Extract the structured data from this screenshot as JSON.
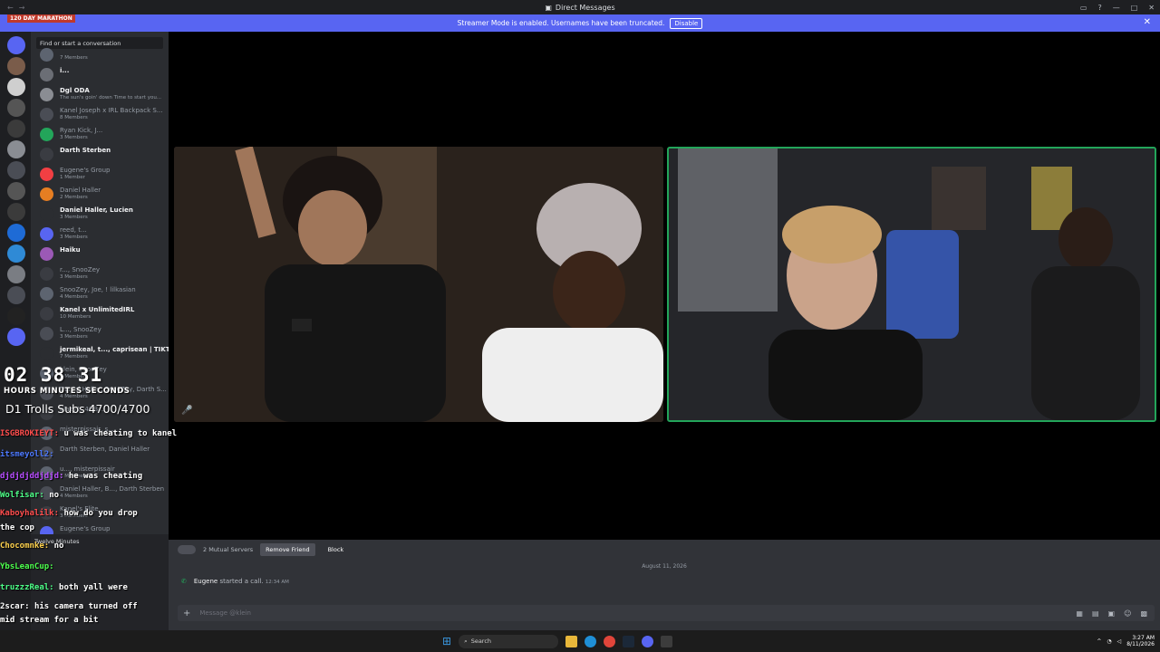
{
  "window": {
    "title": "Direct Messages"
  },
  "banner": {
    "text": "Streamer Mode is enabled. Usernames have been truncated.",
    "button": "Disable"
  },
  "search": {
    "placeholder": "Find or start a conversation"
  },
  "stream_overlay": {
    "marathon": "120 DAY MARATHON",
    "timer": "02 38 31",
    "units": "HOURS  MINUTES  SECONDS",
    "subs": "D1 Trolls Subs 4700/4700"
  },
  "dms": [
    {
      "name": "",
      "sub": "7 Members",
      "bold": false,
      "color": "#5d6470"
    },
    {
      "name": "i...",
      "sub": "",
      "bold": true,
      "color": "#6b6e75"
    },
    {
      "name": "Dgl",
      "tag": "ODA",
      "sub": "The sun's goin' down Time to start you...",
      "bold": true,
      "color": "#8a8d93"
    },
    {
      "name": "Kanel Joseph x IRL Backpack S...",
      "sub": "8 Members",
      "bold": false,
      "color": "#4a4d55"
    },
    {
      "name": "Ryan Kick, J...",
      "sub": "3 Members",
      "bold": false,
      "color": "#23a55a"
    },
    {
      "name": "Darth Sterben",
      "sub": "",
      "bold": true,
      "color": "#3a3c42"
    },
    {
      "name": "Eugene's Group",
      "sub": "1 Member",
      "bold": false,
      "color": "#f23f43"
    },
    {
      "name": "Daniel Haller",
      "sub": "2 Members",
      "bold": false,
      "color": "#e67e22"
    },
    {
      "name": "Daniel Haller, Lucien",
      "sub": "3 Members",
      "bold": true,
      "color": "#2b2d31"
    },
    {
      "name": "reed, t...",
      "sub": "3 Members",
      "bold": false,
      "color": "#5865f2"
    },
    {
      "name": "Haiku",
      "sub": "",
      "bold": true,
      "color": "#9b59b6"
    },
    {
      "name": "r..., SnooZey",
      "sub": "3 Members",
      "bold": false,
      "color": "#3a3c42"
    },
    {
      "name": "SnooZey, Joe, ! lilkasian",
      "sub": "4 Members",
      "bold": false,
      "color": "#5d6470"
    },
    {
      "name": "Kanel x UnlimitedIRL",
      "sub": "10 Members",
      "bold": true,
      "color": "#3a3c42"
    },
    {
      "name": "L..., SnooZey",
      "sub": "3 Members",
      "bold": false,
      "color": "#4a4d55"
    },
    {
      "name": "jermikeal, t..., caprisean | TIKTO...",
      "sub": "7 Members",
      "bold": true,
      "color": "#2b2d31"
    },
    {
      "name": "klein, SnooZey",
      "sub": "3 Members",
      "bold": false,
      "color": "#5d6470"
    },
    {
      "name": "Daniel Haller, SnooZey, Darth S...",
      "sub": "4 Members",
      "bold": false,
      "color": "#4a4d55"
    },
    {
      "name": "blazy1, 4GB...",
      "sub": "",
      "bold": false,
      "color": "#3a3c42"
    },
    {
      "name": "misterpissair, s...",
      "sub": "",
      "bold": false,
      "color": "#5d6470"
    },
    {
      "name": "Darth Sterben, Daniel Haller",
      "sub": "",
      "bold": false,
      "color": "#4a4d55"
    },
    {
      "name": "u..., misterpissair",
      "sub": "3 Members",
      "bold": false,
      "color": "#5d6470"
    },
    {
      "name": "Daniel Haller, B..., Darth Sterben",
      "sub": "4 Members",
      "bold": false,
      "color": "#4a4d55"
    },
    {
      "name": "Kanel's Elite",
      "sub": "3 Members",
      "bold": false,
      "color": "#3a3c42"
    },
    {
      "name": "Eugene's Group",
      "sub": "",
      "bold": false,
      "color": "#5865f2"
    }
  ],
  "chat": [
    {
      "user": "ISGBROKIEYT:",
      "msg": "u was cheating to kanel",
      "ucolor": "#ff4d4d"
    },
    {
      "user": "itsmeyoll2:",
      "msg": "",
      "ucolor": "#4d79ff"
    },
    {
      "user": "djdjdjddjdjd:",
      "msg": "he was cheating",
      "ucolor": "#b84dff"
    },
    {
      "user": "Wolfisar:",
      "msg": "no",
      "ucolor": "#4dff88"
    },
    {
      "user": "Kaboyhalilk:",
      "msg": "how do you drop",
      "ucolor": "#ff4d4d"
    },
    {
      "user": "",
      "msg": "the cop",
      "ucolor": "#ffffff"
    },
    {
      "user": "Chocomnke:",
      "msg": "no",
      "ucolor": "#ffd24d"
    },
    {
      "user": "YbsLeanCup:",
      "msg": "",
      "ucolor": "#4dff4d"
    },
    {
      "user": "truzzzReal:",
      "msg": "both yall were",
      "ucolor": "#4dff88"
    },
    {
      "user": "2scar:",
      "msg": "his camera turned off",
      "ucolor": "#ffffff"
    },
    {
      "user": "",
      "msg": "mid stream for a bit",
      "ucolor": "#ffffff"
    }
  ],
  "user_panel": {
    "status": "Twelve Minutes"
  },
  "profile": {
    "mutual": "2 Mutual Servers",
    "remove": "Remove Friend",
    "block": "Block"
  },
  "conversation": {
    "date": "August 11, 2026",
    "caller": "Eugene",
    "action": "started a call.",
    "time": "12:34 AM"
  },
  "composer": {
    "placeholder": "Message @klein"
  },
  "taskbar": {
    "search": "Search",
    "time": "3:27 AM",
    "date": "8/11/2026"
  }
}
